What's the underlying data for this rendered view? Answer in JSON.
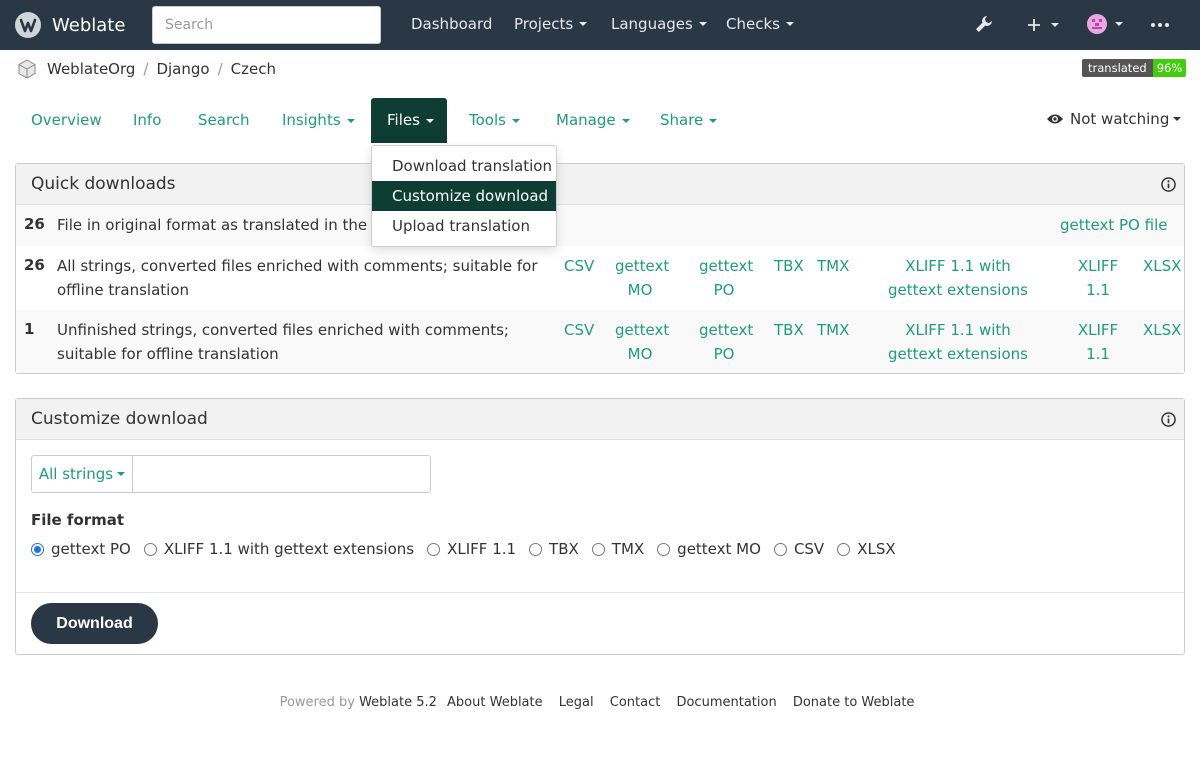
{
  "navbar": {
    "brand": "Weblate",
    "search_placeholder": "Search",
    "links": [
      "Dashboard",
      "Projects",
      "Languages",
      "Checks"
    ]
  },
  "breadcrumb": [
    "WeblateOrg",
    "Django",
    "Czech"
  ],
  "badge": {
    "label": "translated",
    "value": "96%"
  },
  "tabs": [
    "Overview",
    "Info",
    "Search",
    "Insights",
    "Files",
    "Tools",
    "Manage",
    "Share"
  ],
  "watch_label": "Not watching",
  "files_menu": [
    "Download translation",
    "Customize download",
    "Upload translation"
  ],
  "quick": {
    "title": "Quick downloads",
    "rows": [
      {
        "count": "26",
        "desc": "File in original format as translated in the repository",
        "links": [
          "gettext PO file"
        ]
      },
      {
        "count": "26",
        "desc": "All strings, converted files enriched with comments; suitable for offline translation",
        "links": [
          "CSV",
          "gettext MO",
          "gettext PO",
          "TBX",
          "TMX",
          "XLIFF 1.1 with gettext extensions",
          "XLIFF 1.1",
          "XLSX"
        ]
      },
      {
        "count": "1",
        "desc": "Unfinished strings, converted files enriched with comments; suitable for offline translation",
        "links": [
          "CSV",
          "gettext MO",
          "gettext PO",
          "TBX",
          "TMX",
          "XLIFF 1.1 with gettext extensions",
          "XLIFF 1.1",
          "XLSX"
        ]
      }
    ]
  },
  "customize": {
    "title": "Customize download",
    "filter_label": "All strings",
    "format_label": "File format",
    "formats": [
      "gettext PO",
      "XLIFF 1.1 with gettext extensions",
      "XLIFF 1.1",
      "TBX",
      "TMX",
      "gettext MO",
      "CSV",
      "XLSX"
    ],
    "selected_format": "gettext PO",
    "download_label": "Download"
  },
  "footer": {
    "powered": "Powered by",
    "version": "Weblate 5.2",
    "links": [
      "About Weblate",
      "Legal",
      "Contact",
      "Documentation",
      "Donate to Weblate"
    ]
  },
  "colors": {
    "navbar": "#2a3744",
    "accent": "#1f9d7a",
    "active": "#0e3d34",
    "badge_ok": "#44cc11"
  }
}
